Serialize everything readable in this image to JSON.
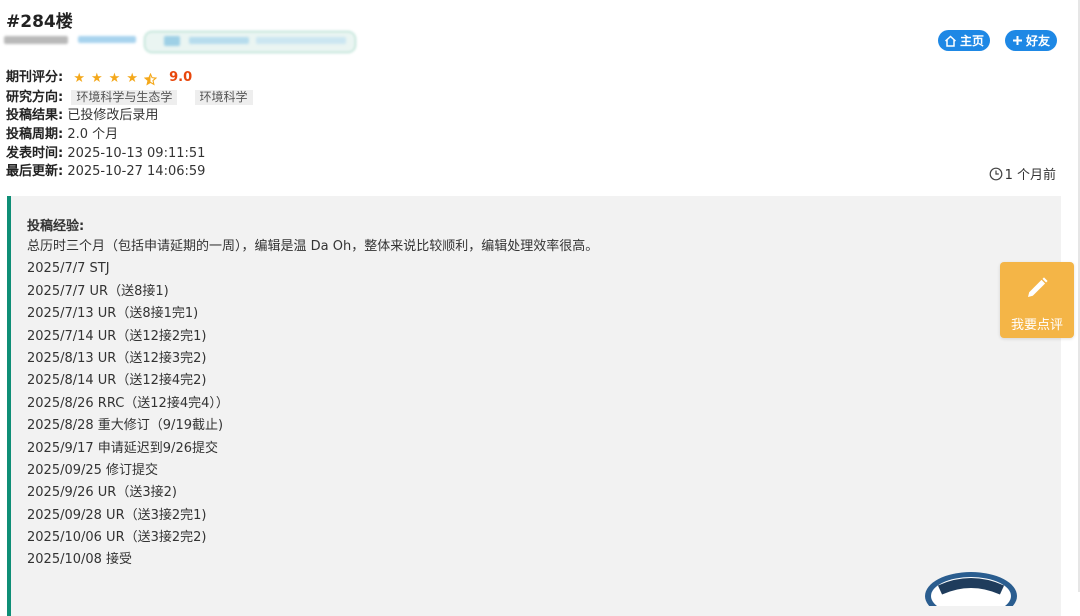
{
  "post": {
    "floor": "#284楼",
    "buttons": {
      "home": "主页",
      "friend": "好友"
    },
    "rating": {
      "label": "期刊评分:",
      "stars": 4.5,
      "score": "9.0"
    },
    "direction": {
      "label": "研究方向:",
      "tags": [
        "环境科学与生态学",
        "环境科学"
      ]
    },
    "result": {
      "label": "投稿结果:",
      "value": "已投修改后录用"
    },
    "cycle": {
      "label": "投稿周期:",
      "value": "2.0 个月"
    },
    "published": {
      "label": "发表时间:",
      "value": "2025-10-13 09:11:51"
    },
    "updated": {
      "label": "最后更新:",
      "value": "2025-10-27 14:06:59"
    },
    "time_ago": "1 个月前"
  },
  "experience": {
    "title": "投稿经验:",
    "lines": [
      "总历时三个月（包括申请延期的一周），编辑是温 Da Oh，整体来说比较顺利，编辑处理效率很高。",
      "2025/7/7 STJ",
      "2025/7/7 UR（送8接1)",
      "2025/7/13 UR（送8接1完1)",
      "2025/7/14 UR（送12接2完1)",
      "2025/8/13 UR（送12接3完2)",
      "2025/8/14 UR（送12接4完2)",
      "2025/8/26 RRC（送12接4完4））",
      "2025/8/28 重大修订（9/19截止)",
      "2025/9/17 申请延迟到9/26提交",
      "2025/09/25 修订提交",
      "2025/9/26 UR（送3接2)",
      "2025/09/28 UR（送3接2完1)",
      "2025/10/06 UR（送3接2完2)",
      "2025/10/08 接受"
    ]
  },
  "sidebar": {
    "review_button": "我要点评"
  },
  "colors": {
    "accent_blue": "#1e88e5",
    "star": "#f4a81b",
    "score": "#e8470c",
    "panel_border": "#0f8e76",
    "review_button": "#f4b547"
  },
  "icons": [
    "home-icon",
    "plus-icon",
    "star-icon",
    "clock-icon",
    "pencil-icon"
  ]
}
